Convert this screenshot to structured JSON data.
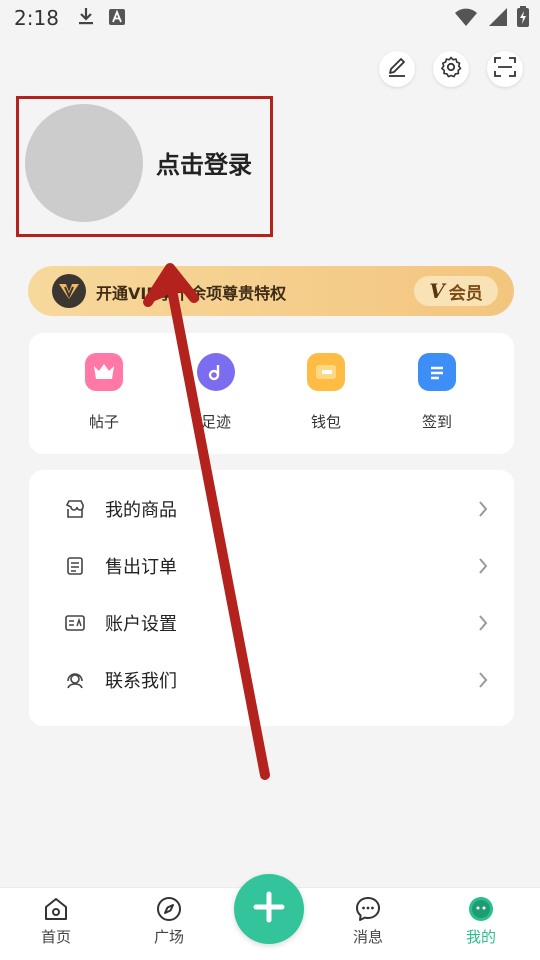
{
  "status_bar": {
    "time": "2:18"
  },
  "top_actions": {
    "edit": "edit-icon",
    "settings": "gear-icon",
    "scan": "scan-icon"
  },
  "profile": {
    "login_text": "点击登录"
  },
  "vip_banner": {
    "text": "开通VIP享十余项尊贵特权",
    "badge_v": "V",
    "badge_text": "会员"
  },
  "quick_actions": [
    {
      "label": "帖子",
      "icon": "crown-icon",
      "color": "#ff6fa0"
    },
    {
      "label": "足迹",
      "icon": "footprint-icon",
      "color": "#7b6cf0"
    },
    {
      "label": "钱包",
      "icon": "wallet-icon",
      "color": "#ffb83d"
    },
    {
      "label": "签到",
      "icon": "checkin-icon",
      "color": "#3d8ef7"
    }
  ],
  "menu": [
    {
      "label": "我的商品",
      "icon": "store-icon"
    },
    {
      "label": "售出订单",
      "icon": "order-icon"
    },
    {
      "label": "账户设置",
      "icon": "account-icon"
    },
    {
      "label": "联系我们",
      "icon": "support-icon"
    }
  ],
  "tabs": [
    {
      "label": "首页",
      "icon": "home-icon"
    },
    {
      "label": "广场",
      "icon": "compass-icon"
    },
    {
      "label": "消息",
      "icon": "message-icon"
    },
    {
      "label": "我的",
      "icon": "profile-icon",
      "active": true
    }
  ],
  "colors": {
    "accent": "#33c49b",
    "annotation": "#b3221d",
    "vip": "#f3c57f"
  }
}
